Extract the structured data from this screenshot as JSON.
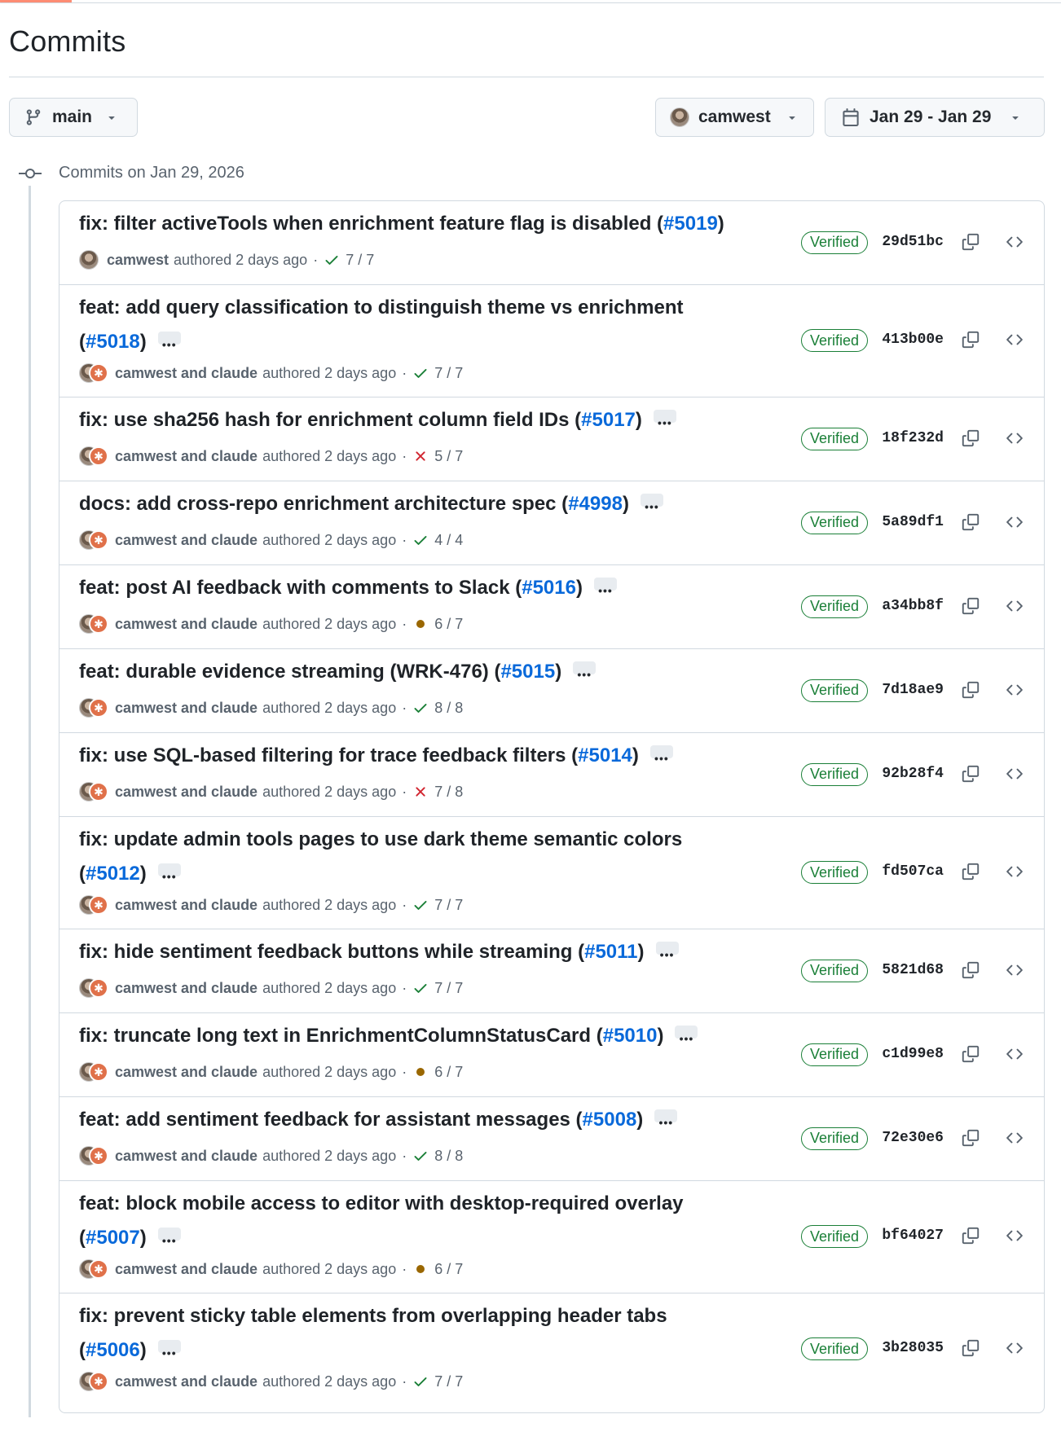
{
  "page_title": "Commits",
  "filters": {
    "branch": "main",
    "author": "camwest",
    "date_range": "Jan 29 - Jan 29"
  },
  "group_title": "Commits on Jan 29, 2026",
  "verified_label": "Verified",
  "commits": [
    {
      "title": "fix: filter activeTools when enrichment feature flag is disabled (",
      "title2": "",
      "pr": "#5019",
      "suffix": ")",
      "author_line": "camwest",
      "authored": "authored 2 days ago",
      "status": "pass",
      "checks": "7 / 7",
      "sha": "29d51bc",
      "coauthored": false,
      "more": false
    },
    {
      "title": "feat: add query classification to distinguish theme vs enrichment",
      "title2": "(",
      "pr": "#5018",
      "suffix": ")",
      "author_line": "camwest and claude",
      "authored": "authored 2 days ago",
      "status": "pass",
      "checks": "7 / 7",
      "sha": "413b00e",
      "coauthored": true,
      "more": true
    },
    {
      "title": "fix: use sha256 hash for enrichment column field IDs (",
      "title2": "",
      "pr": "#5017",
      "suffix": ")",
      "author_line": "camwest and claude",
      "authored": "authored 2 days ago",
      "status": "fail",
      "checks": "5 / 7",
      "sha": "18f232d",
      "coauthored": true,
      "more": true
    },
    {
      "title": "docs: add cross-repo enrichment architecture spec (",
      "title2": "",
      "pr": "#4998",
      "suffix": ")",
      "author_line": "camwest and claude",
      "authored": "authored 2 days ago",
      "status": "pass",
      "checks": "4 / 4",
      "sha": "5a89df1",
      "coauthored": true,
      "more": true
    },
    {
      "title": "feat: post AI feedback with comments to Slack (",
      "title2": "",
      "pr": "#5016",
      "suffix": ")",
      "author_line": "camwest and claude",
      "authored": "authored 2 days ago",
      "status": "pending",
      "checks": "6 / 7",
      "sha": "a34bb8f",
      "coauthored": true,
      "more": true
    },
    {
      "title": "feat: durable evidence streaming (WRK-476) (",
      "title2": "",
      "pr": "#5015",
      "suffix": ")",
      "author_line": "camwest and claude",
      "authored": "authored 2 days ago",
      "status": "pass",
      "checks": "8 / 8",
      "sha": "7d18ae9",
      "coauthored": true,
      "more": true
    },
    {
      "title": "fix: use SQL-based filtering for trace feedback filters (",
      "title2": "",
      "pr": "#5014",
      "suffix": ")",
      "author_line": "camwest and claude",
      "authored": "authored 2 days ago",
      "status": "fail",
      "checks": "7 / 8",
      "sha": "92b28f4",
      "coauthored": true,
      "more": true
    },
    {
      "title": "fix: update admin tools pages to use dark theme semantic colors",
      "title2": "(",
      "pr": "#5012",
      "suffix": ")",
      "author_line": "camwest and claude",
      "authored": "authored 2 days ago",
      "status": "pass",
      "checks": "7 / 7",
      "sha": "fd507ca",
      "coauthored": true,
      "more": true
    },
    {
      "title": "fix: hide sentiment feedback buttons while streaming (",
      "title2": "",
      "pr": "#5011",
      "suffix": ")",
      "author_line": "camwest and claude",
      "authored": "authored 2 days ago",
      "status": "pass",
      "checks": "7 / 7",
      "sha": "5821d68",
      "coauthored": true,
      "more": true
    },
    {
      "title": "fix: truncate long text in EnrichmentColumnStatusCard (",
      "title2": "",
      "pr": "#5010",
      "suffix": ")",
      "author_line": "camwest and claude",
      "authored": "authored 2 days ago",
      "status": "pending",
      "checks": "6 / 7",
      "sha": "c1d99e8",
      "coauthored": true,
      "more": true
    },
    {
      "title": "feat: add sentiment feedback for assistant messages (",
      "title2": "",
      "pr": "#5008",
      "suffix": ")",
      "author_line": "camwest and claude",
      "authored": "authored 2 days ago",
      "status": "pass",
      "checks": "8 / 8",
      "sha": "72e30e6",
      "coauthored": true,
      "more": true
    },
    {
      "title": "feat: block mobile access to editor with desktop-required overlay",
      "title2": "(",
      "pr": "#5007",
      "suffix": ")",
      "author_line": "camwest and claude",
      "authored": "authored 2 days ago",
      "status": "pending",
      "checks": "6 / 7",
      "sha": "bf64027",
      "coauthored": true,
      "more": true
    },
    {
      "title": "fix: prevent sticky table elements from overlapping header tabs",
      "title2": "(",
      "pr": "#5006",
      "suffix": ")",
      "author_line": "camwest and claude",
      "authored": "authored 2 days ago",
      "status": "pass",
      "checks": "7 / 7",
      "sha": "3b28035",
      "coauthored": true,
      "more": true
    }
  ],
  "colors": {
    "link": "#0969da",
    "success": "#1a7f37",
    "danger": "#d1242f",
    "pending": "#9a6700",
    "border": "#d1d9e0",
    "muted": "#59636e"
  },
  "icons": {
    "branch": "git-branch-icon",
    "calendar": "calendar-icon",
    "caret": "triangle-down-icon",
    "commit": "git-commit-icon",
    "copy": "copy-icon",
    "browse": "code-icon",
    "pass": "check-icon",
    "fail": "x-icon",
    "pending": "dot-fill-icon",
    "more": "kebab-horizontal-icon"
  }
}
